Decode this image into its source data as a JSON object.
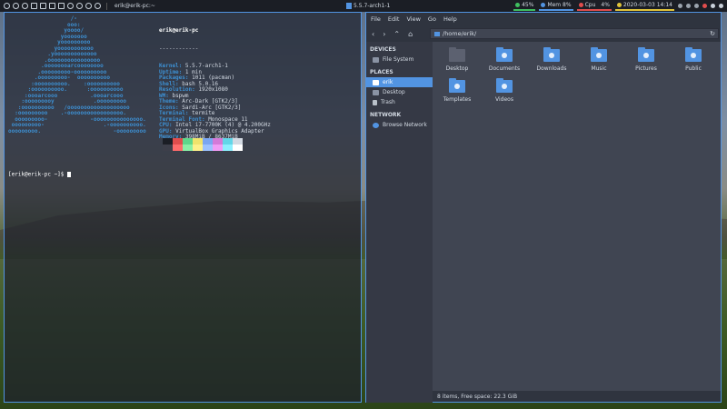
{
  "topbar": {
    "window_title": "erik@erik-pc:~",
    "center_label": "5.5.7-arch1-1",
    "battery": "45%",
    "mem": "Mem 8%",
    "cpu_label": "Cpu",
    "cpu_value": "4%",
    "clock": "2020-03-03 14:14"
  },
  "terminal": {
    "logo_lines": [
      "                   /-",
      "                  ooo:",
      "                 yoooo/",
      "                yooooooo",
      "               yooooooooo",
      "              yooooooooooo",
      "            .yooooooooooooo",
      "           .oooooooooooooooo",
      "          .oooooooarcoooooooo",
      "         .ooooooooo-oooooooooo",
      "        .ooooooooo-  oooooooooo",
      "       :oooooooooo.    :oooooooooo",
      "      :oooooooooo.      :oooooooooo",
      "     :oooarcooo          .oooarcooo",
      "    :ooooooooy            .ooooooooo",
      "   :oooooooooo   /ooooooooooooooooooo",
      "  :ooooooooo    .-ooooooooooooooooo.",
      "  ooooooooo-             -ooooooooooooooo.",
      " ooooooooo-                  .-oooooooooo.",
      "ooooooooo.                      -ooooooooo"
    ],
    "user_host": "erik@erik-pc",
    "separator": "------------",
    "info": [
      {
        "key": "Kernel:",
        "value": " 5.5.7-arch1-1"
      },
      {
        "key": "Uptime:",
        "value": " 1 min"
      },
      {
        "key": "Packages:",
        "value": " 1011 (pacman)"
      },
      {
        "key": "Shell:",
        "value": " bash 5.0.16"
      },
      {
        "key": "Resolution:",
        "value": " 1920x1080"
      },
      {
        "key": "WM:",
        "value": " bspwm"
      },
      {
        "key": "Theme:",
        "value": " Arc-Dark [GTK2/3]"
      },
      {
        "key": "Icons:",
        "value": " Sardi-Arc [GTK2/3]"
      },
      {
        "key": "Terminal:",
        "value": " termite"
      },
      {
        "key": "Terminal Font:",
        "value": " Monospace 11"
      },
      {
        "key": "CPU:",
        "value": " Intel i7-7700K (4) @ 4.200GHz"
      },
      {
        "key": "GPU:",
        "value": " VirtualBox Graphics Adapter"
      },
      {
        "key": "Memory:",
        "value": " 398MiB / 8637MiB"
      }
    ],
    "swatches_top": [
      "#1b1e25",
      "#e04d4d",
      "#5ed68a",
      "#f0e36c",
      "#7aa6f2",
      "#d47ad8",
      "#62d6e8",
      "#d3dae3"
    ],
    "swatches_bottom": [
      "#3d3f4a",
      "#ff6b6b",
      "#8af0a6",
      "#fff08a",
      "#9cc2ff",
      "#f29cf5",
      "#8cf0ff",
      "#ffffff"
    ],
    "prompt": "[erik@erik-pc ~]$ "
  },
  "filemanager": {
    "menu": [
      "File",
      "Edit",
      "View",
      "Go",
      "Help"
    ],
    "path": "/home/erik/",
    "sidebar": {
      "devices_heading": "DEVICES",
      "devices": [
        {
          "label": "File System",
          "icon": "drive-icon"
        }
      ],
      "places_heading": "PLACES",
      "places": [
        {
          "label": "erik",
          "icon": "home-icon"
        },
        {
          "label": "Desktop",
          "icon": "folder-icon"
        },
        {
          "label": "Trash",
          "icon": "trash-icon"
        }
      ],
      "network_heading": "NETWORK",
      "network": [
        {
          "label": "Browse Network",
          "icon": "network-icon"
        }
      ]
    },
    "items": [
      {
        "label": "Desktop",
        "icon": "desktop-folder-icon"
      },
      {
        "label": "Documents",
        "icon": "documents-folder-icon"
      },
      {
        "label": "Downloads",
        "icon": "downloads-folder-icon"
      },
      {
        "label": "Music",
        "icon": "music-folder-icon"
      },
      {
        "label": "Pictures",
        "icon": "pictures-folder-icon"
      },
      {
        "label": "Public",
        "icon": "public-folder-icon"
      },
      {
        "label": "Templates",
        "icon": "templates-folder-icon"
      },
      {
        "label": "Videos",
        "icon": "videos-folder-icon"
      }
    ],
    "status": "8 items, Free space: 22.3 GiB"
  },
  "colors": {
    "accent": "#5294e2",
    "panel": "#383c4a",
    "bar": "#1b1e25"
  }
}
